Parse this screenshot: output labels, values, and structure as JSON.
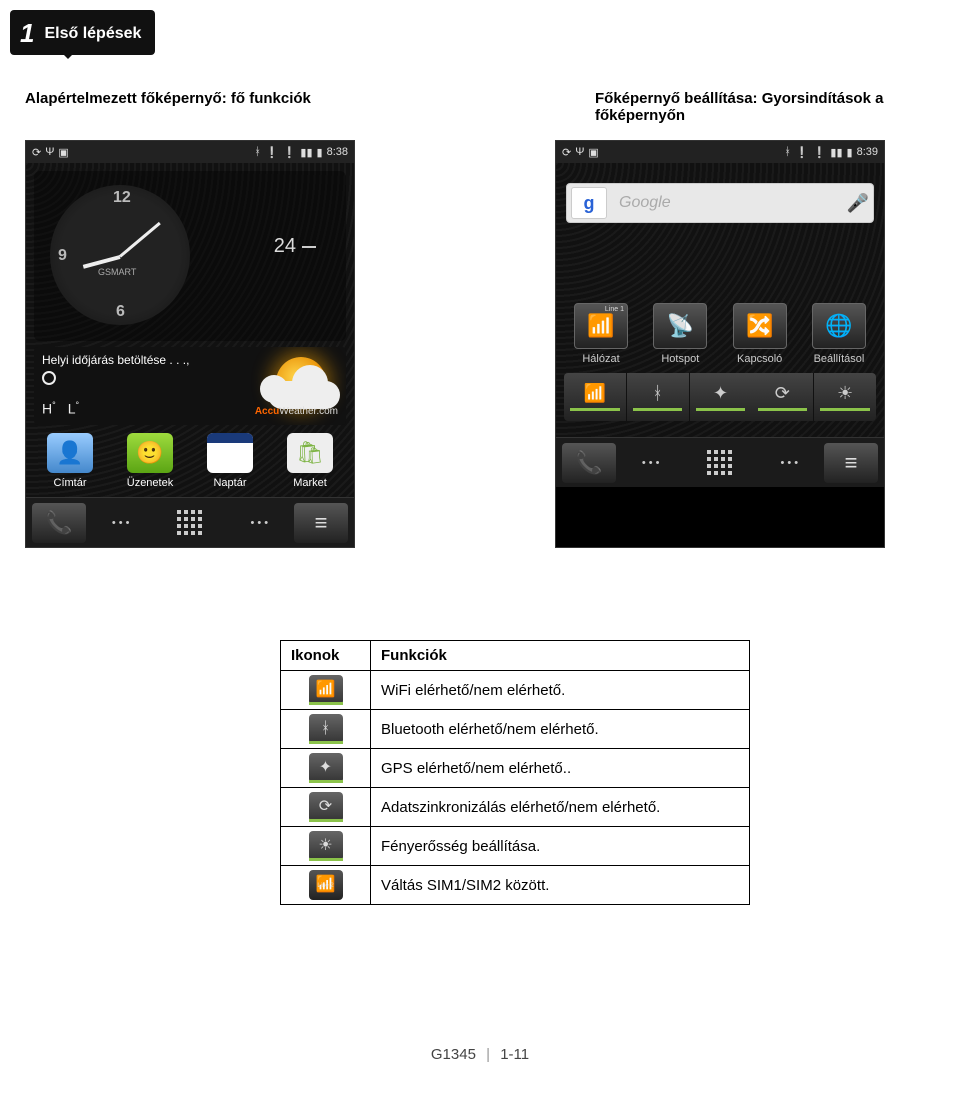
{
  "chapter": {
    "number": "1",
    "title": "Első lépések"
  },
  "captions": {
    "left": "Alapértelmezett főképernyő: fő funkciók",
    "right_line1": "Főképernyő beállítása: Gyorsindítások a",
    "right_line2": "főképernyőn"
  },
  "screen_left": {
    "time": "8:38",
    "clock": {
      "n12": "12",
      "n9": "9",
      "n6": "6",
      "brand": "GSMART",
      "date": "24"
    },
    "weather": {
      "loading": "Helyi időjárás betöltése . . .,",
      "hi": "H",
      "lo": "L",
      "provider_bold": "Accu",
      "provider_rest": "Weather.com"
    },
    "apps": [
      {
        "id": "cimtar",
        "label": "Címtár"
      },
      {
        "id": "uzenetek",
        "label": "Üzenetek"
      },
      {
        "id": "naptar",
        "label": "Naptár"
      },
      {
        "id": "market",
        "label": "Market"
      }
    ]
  },
  "screen_right": {
    "time": "8:39",
    "search": {
      "logo": "g",
      "placeholder": "Google"
    },
    "shortcuts": [
      {
        "id": "halozat",
        "label": "Hálózat",
        "line1": "Line 1"
      },
      {
        "id": "hotspot",
        "label": "Hotspot"
      },
      {
        "id": "kapcsolo",
        "label": "Kapcsoló"
      },
      {
        "id": "beallitasok",
        "label": "Beállításol"
      }
    ]
  },
  "icon_table": {
    "header_icons": "Ikonok",
    "header_func": "Funkciók",
    "rows": [
      {
        "icon": "wifi",
        "desc": "WiFi elérhető/nem elérhető."
      },
      {
        "icon": "bt",
        "desc": "Bluetooth elérhető/nem elérhető."
      },
      {
        "icon": "gps",
        "desc": "GPS elérhető/nem elérhető.."
      },
      {
        "icon": "sync",
        "desc": "Adatszinkronizálás elérhető/nem elérhető."
      },
      {
        "icon": "bright",
        "desc": "Fényerősség beállítása."
      },
      {
        "icon": "sim",
        "desc": "Váltás SIM1/SIM2 között."
      }
    ]
  },
  "footer": {
    "model": "G1345",
    "page": "1-11"
  }
}
